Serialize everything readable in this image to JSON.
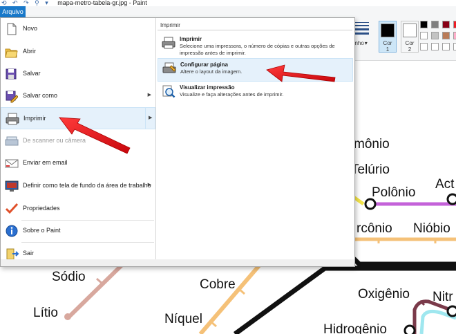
{
  "window": {
    "title": "mapa-metro-tabela-gr.jpg - Paint",
    "quick_access": "⟲ ↶ ↷ ⚲ ▾"
  },
  "ribbon": {
    "file_tab": "Arquivo",
    "size_label": "anho",
    "color1_label": "Cor",
    "color1_num": "1",
    "color2_label": "Cor",
    "color2_num": "2",
    "palette": [
      "#000000",
      "#7f7f7f",
      "#880015",
      "#ed1c24",
      "#ffffff",
      "#c3c3c3",
      "#b97a57",
      "#ffaec9",
      "#ffffff",
      "#ffffff",
      "#ffffff",
      "#ffffff"
    ]
  },
  "menu": {
    "items": [
      {
        "label": "Novo",
        "icon": "new-document-icon"
      },
      {
        "label": "Abrir",
        "icon": "open-folder-icon"
      },
      {
        "label": "Salvar",
        "icon": "save-disk-icon"
      },
      {
        "label": "Salvar como",
        "icon": "save-as-icon"
      },
      {
        "label": "Imprimir",
        "icon": "printer-icon"
      },
      {
        "label": "De scanner ou câmera",
        "icon": "scanner-icon"
      },
      {
        "label": "Enviar em email",
        "icon": "email-icon"
      },
      {
        "label": "Definir como tela de fundo da área de trabalho",
        "icon": "desktop-icon"
      },
      {
        "label": "Propriedades",
        "icon": "checkmark-icon"
      },
      {
        "label": "Sobre o Paint",
        "icon": "info-icon"
      },
      {
        "label": "Sair",
        "icon": "exit-icon"
      }
    ],
    "submenu": {
      "header": "Imprimir",
      "items": [
        {
          "title": "Imprimir",
          "desc": "Selecione uma impressora, o número de cópias e outras opções de impressão antes de imprimir.",
          "icon": "printer-icon"
        },
        {
          "title": "Configurar página",
          "desc": "Altere o layout da imagem.",
          "icon": "page-setup-icon"
        },
        {
          "title": "Visualizar impressão",
          "desc": "Visualize e faça alterações antes de imprimir.",
          "icon": "print-preview-icon"
        }
      ]
    }
  },
  "map": {
    "stations": [
      "mônio",
      "Telúrio",
      "Polônio",
      "Act",
      "rcônio",
      "Nióbio",
      "Sódio",
      "Cobre",
      "Lítio",
      "Níquel",
      "Oxigênio",
      "Nitr",
      "Hidrogênio"
    ]
  },
  "colors": {
    "accent": "#1979ca",
    "highlight": "#e5f1fb",
    "arrow": "#e8141b"
  }
}
